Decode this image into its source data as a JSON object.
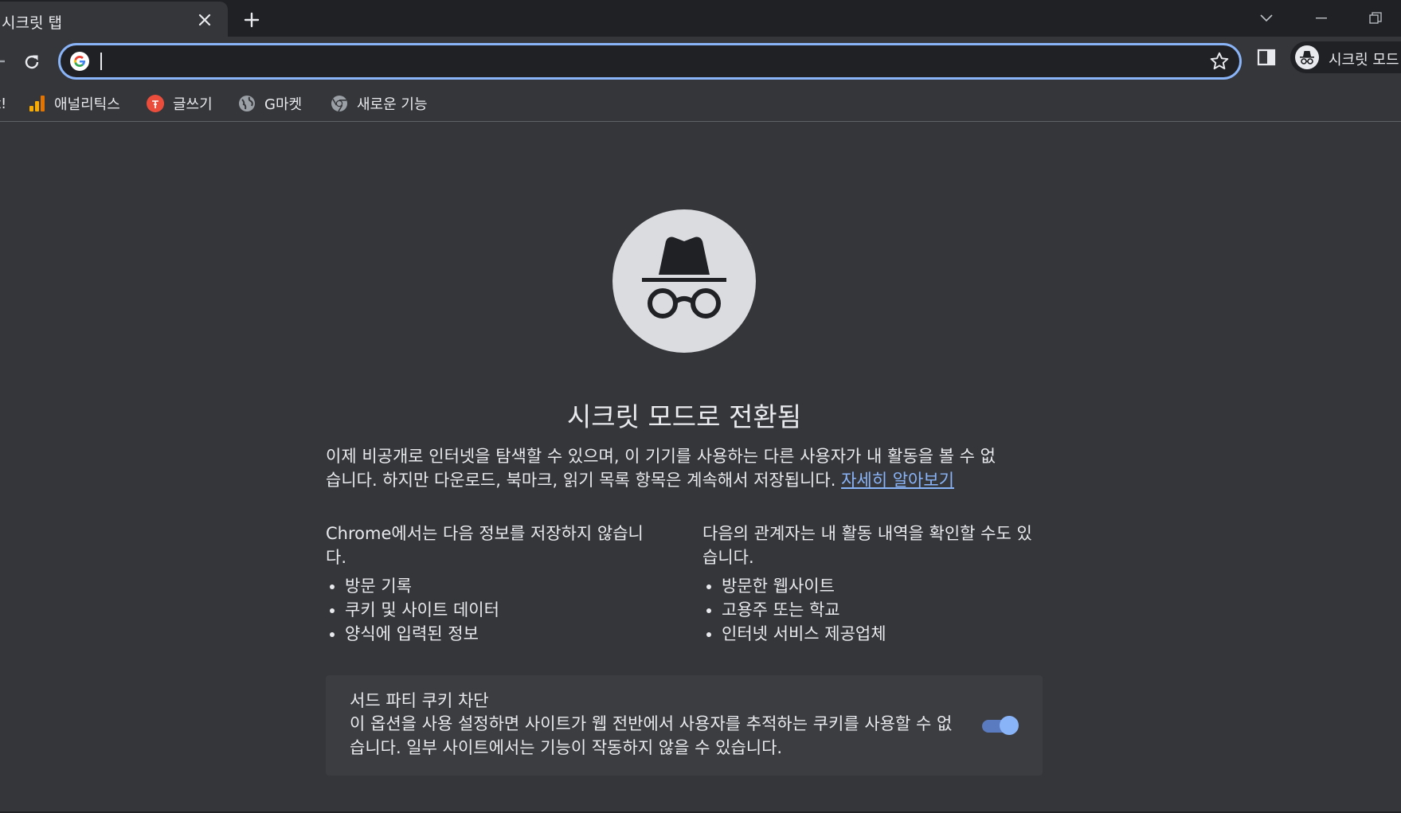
{
  "tab": {
    "title": "시크릿 탭"
  },
  "omnibox": {
    "value": "",
    "placeholder": ""
  },
  "profile": {
    "label": "시크릿 모드"
  },
  "bookmarks": {
    "cut_label": "t!",
    "items": [
      {
        "label": "애널리틱스",
        "icon": "analytics-icon"
      },
      {
        "label": "글쓰기",
        "icon": "write-icon"
      },
      {
        "label": "G마켓",
        "icon": "globe-icon"
      },
      {
        "label": "새로운 기능",
        "icon": "chrome-icon"
      }
    ]
  },
  "page": {
    "heading": "시크릿 모드로 전환됨",
    "intro_line1": "이제 비공개로 인터넷을 탐색할 수 있으며, 이 기기를 사용하는 다른 사용자가 내 활동을 볼 수 없",
    "intro_line2": "습니다. 하지만 다운로드, 북마크, 읽기 목록 항목은 계속해서 저장됩니다. ",
    "learn_more": "자세히 알아보기",
    "not_saved": {
      "title": "Chrome에서는 다음 정보를 저장하지 않습니다.",
      "items": [
        "방문 기록",
        "쿠키 및 사이트 데이터",
        "양식에 입력된 정보"
      ]
    },
    "visible_to": {
      "title": "다음의 관계자는 내 활동 내역을 확인할 수도 있습니다.",
      "items": [
        "방문한 웹사이트",
        "고용주 또는 학교",
        "인터넷 서비스 제공업체"
      ]
    },
    "cookie_card": {
      "title": "서드 파티 쿠키 차단",
      "description": "이 옵션을 사용 설정하면 사이트가 웹 전반에서 사용자를 추적하는 쿠키를 사용할 수 없습니다. 일부 사이트에서는 기능이 작동하지 않을 수 있습니다.",
      "toggle_on": true
    }
  },
  "colors": {
    "background": "#35363a",
    "titlebar": "#202124",
    "accent": "#8ab4f8",
    "text": "#e8eaed"
  }
}
